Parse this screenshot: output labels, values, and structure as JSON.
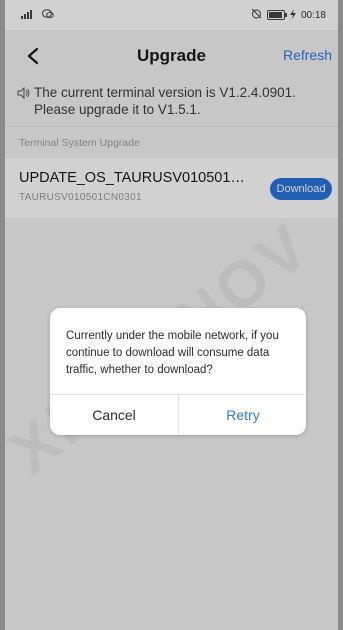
{
  "status_bar": {
    "signal_text": "ºıll",
    "carrier_icon": "wechat-icon",
    "right_icons": "alarm-icon",
    "battery_level": 0.9,
    "time": "00:18"
  },
  "header": {
    "title": "Upgrade",
    "refresh_label": "Refresh",
    "back_icon": "chevron-left-icon"
  },
  "notice": {
    "text": "The current terminal version is V1.2.4.0901. Please upgrade it to V1.5.1."
  },
  "section": {
    "label": "Terminal System Upgrade"
  },
  "item": {
    "name": "UPDATE_OS_TAURUSV010501CN...",
    "sub": "TAURUSV010501CN0301",
    "download_label": "Download"
  },
  "dialog": {
    "message": "Currently under the mobile network, if you continue to download will consume data traffic, whether to download?",
    "cancel_label": "Cancel",
    "retry_label": "Retry"
  },
  "watermark": {
    "text": "XI'AN NOV"
  },
  "colors": {
    "accent": "#2a7de1",
    "download_bg": "#2a74d9",
    "background": "#f3f3f3"
  }
}
